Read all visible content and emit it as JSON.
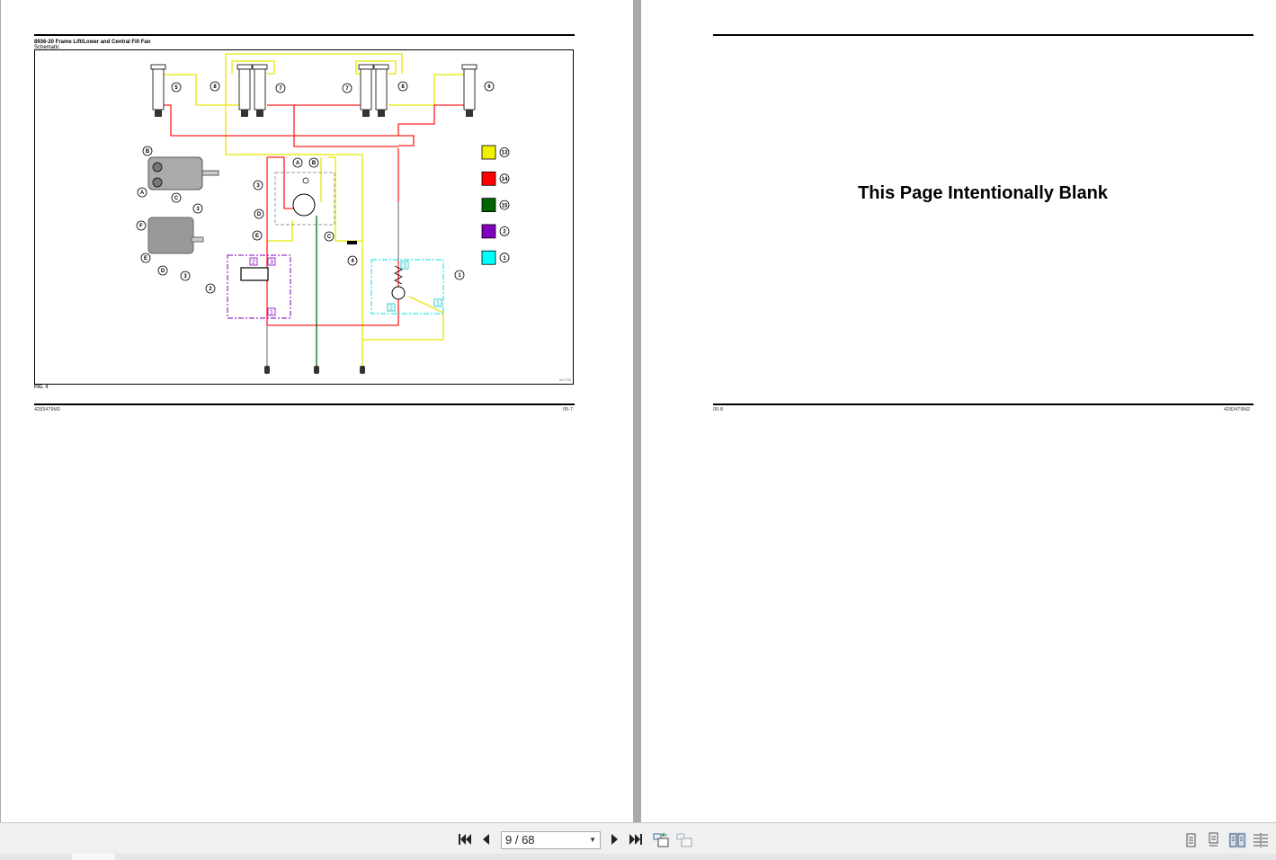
{
  "left_page": {
    "section_title": "8936-20 Frame Lift/Lower and Central Fill Fan",
    "section_subtitle": "Schematic",
    "figure_label": "FIG. 4",
    "figure_id": "IA17733",
    "footer_left": "4283479M2",
    "footer_right": "05-7",
    "schematic": {
      "callouts": [
        "5",
        "8",
        "7",
        "7",
        "8",
        "6",
        "B",
        "A",
        "C",
        "3",
        "F",
        "E",
        "D",
        "3",
        "A",
        "B",
        "3",
        "D",
        "E",
        "C",
        "4",
        "2",
        "1"
      ],
      "port_labels": [
        "2",
        "3",
        "1",
        "3",
        "2",
        "1"
      ],
      "legend": [
        {
          "number": "13",
          "color": "#f0f000"
        },
        {
          "number": "14",
          "color": "#ff0000"
        },
        {
          "number": "15",
          "color": "#006400"
        },
        {
          "number": "2",
          "color": "#8000c0"
        },
        {
          "number": "1",
          "color": "#00ffff"
        }
      ]
    }
  },
  "right_page": {
    "title": "This Page Intentionally Blank",
    "footer_left": "05-8",
    "footer_right": "4283479M2"
  },
  "toolbar": {
    "page_indicator": "9 / 68",
    "current_page": 9,
    "total_pages": 68
  }
}
